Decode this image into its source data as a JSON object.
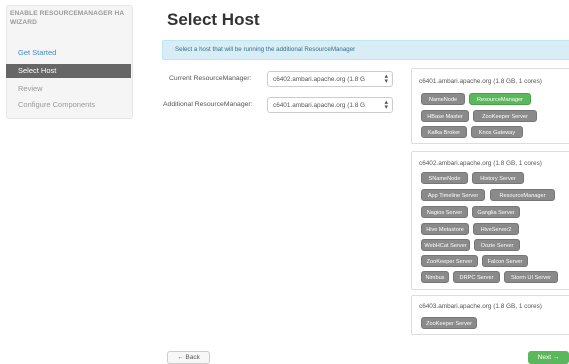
{
  "sidebar": {
    "title": "ENABLE RESOURCEMANAGER HA WIZARD",
    "items": [
      {
        "label": "Get Started"
      },
      {
        "label": "Select Host"
      },
      {
        "label": "Review"
      },
      {
        "label": "Configure Components"
      }
    ]
  },
  "main": {
    "title": "Select Host",
    "info": "Select a host that will be running the additional ResourceManager",
    "current_label": "Current ResourceManager:",
    "current_value": "c6402.ambari.apache.org (1.8 G",
    "additional_label": "Additional ResourceManager:",
    "additional_value": "c6401.ambari.apache.org (1.8 G"
  },
  "hosts": [
    {
      "name": "c6401.ambari.apache.org (1.8 GB, 1 cores)",
      "components": [
        "NameNode",
        "ResourceManager",
        "HBase Master",
        "ZooKeeper Server",
        "Kafka Broker",
        "Knox Gateway"
      ]
    },
    {
      "name": "c6402.ambari.apache.org (1.8 GB, 1 cores)",
      "components": [
        "SNameNode",
        "History Server",
        "App Timeline Server",
        "ResourceManager",
        "Nagios Server",
        "Ganglia Server",
        "Hive Metastore",
        "HiveServer2",
        "WebHCat Server",
        "Oozie Server",
        "ZooKeeper Server",
        "Falcon Server",
        "Nimbus",
        "DRPC Server",
        "Storm UI Server"
      ]
    },
    {
      "name": "c6403.ambari.apache.org (1.8 GB, 1 cores)",
      "components": [
        "ZooKeeper Server"
      ]
    }
  ],
  "footer": {
    "back": "← Back",
    "next": "Next →"
  },
  "colors": {
    "accent": "#428bca",
    "active_nav": "#666666",
    "badge": "#8a8a8a",
    "badge_green": "#5bb75b",
    "info_bg": "#d9edf7"
  }
}
